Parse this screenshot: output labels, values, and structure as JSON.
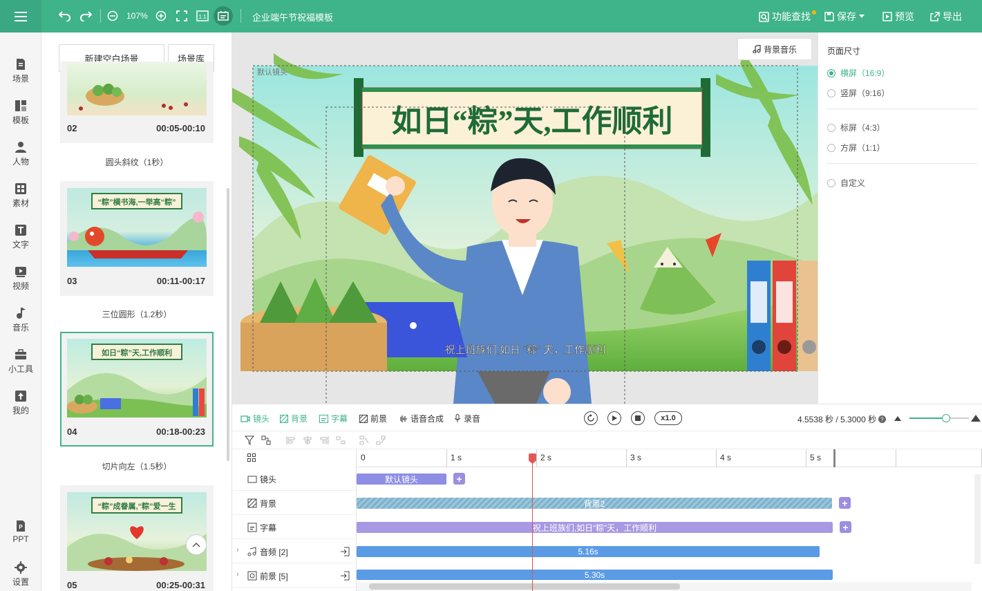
{
  "topbar": {
    "zoom": "107%",
    "title": "企业端午节祝福模板",
    "find_label": "功能查找",
    "save_label": "保存",
    "preview_label": "预览",
    "export_label": "导出"
  },
  "nav": [
    {
      "label": "场景",
      "icon": "scene-icon"
    },
    {
      "label": "模板",
      "icon": "template-icon"
    },
    {
      "label": "人物",
      "icon": "person-icon"
    },
    {
      "label": "素材",
      "icon": "material-icon"
    },
    {
      "label": "文字",
      "icon": "text-icon"
    },
    {
      "label": "视频",
      "icon": "video-icon"
    },
    {
      "label": "音乐",
      "icon": "music-icon"
    },
    {
      "label": "小工具",
      "icon": "toolbox-icon"
    },
    {
      "label": "我的",
      "icon": "upload-icon"
    },
    {
      "label": "PPT",
      "icon": "ppt-icon"
    },
    {
      "label": "设置",
      "icon": "gear-icon"
    }
  ],
  "scenes_panel": {
    "new_label": "新建空白场景",
    "lib_label": "场景库",
    "scenes": [
      {
        "num": "02",
        "time": "00:05-00:10",
        "banner": "",
        "transition": "圆头斜纹（1秒）"
      },
      {
        "num": "03",
        "time": "00:11-00:17",
        "banner": "“粽”横书海,一举高“粽”",
        "transition": "三位圆形（1.2秒）"
      },
      {
        "num": "04",
        "time": "00:18-00:23",
        "banner": "如日“粽”天,工作顺利",
        "transition": "切片向左（1.5秒）"
      },
      {
        "num": "05",
        "time": "00:25-00:31",
        "banner": "“粽”成眷属,“粽”爱一生",
        "transition": ""
      }
    ]
  },
  "canvas": {
    "bgm_label": "背景音乐",
    "camera_tag": "默认镜头",
    "banner": "如日“粽”天,工作顺利",
    "subtitle": "祝上班族们,如日 “粽” 天，工作顺利"
  },
  "page_size": {
    "title": "页面尺寸",
    "options": [
      {
        "label": "横屏（16:9）",
        "selected": true
      },
      {
        "label": "竖屏（9:16）",
        "selected": false
      },
      {
        "label": "标屏（4:3）",
        "selected": false
      },
      {
        "label": "方屏（1:1）",
        "selected": false
      },
      {
        "label": "自定义",
        "selected": false
      }
    ]
  },
  "toolbar": {
    "camera": "镜头",
    "background": "背景",
    "subtitle": "字幕",
    "foreground": "前景",
    "tts": "语音合成",
    "record": "录音",
    "speed": "x1.0",
    "time": "4.5538 秒 / 5.3000 秒"
  },
  "timeline": {
    "ruler": [
      "0",
      "1 s",
      "2 s",
      "3 s",
      "4 s",
      "5 s"
    ],
    "playhead_seconds": 4.5538,
    "duration_seconds": 5.3,
    "rows": [
      {
        "label": "镜头",
        "bar": "默认镜头"
      },
      {
        "label": "背景",
        "bar": "背景2"
      },
      {
        "label": "字幕",
        "bar": "祝上班族们,如日“粽”天，工作顺利"
      },
      {
        "label": "音频 [2]",
        "bar": "5.16s"
      },
      {
        "label": "前景 [5]",
        "bar": "5.30s"
      }
    ]
  },
  "colors": {
    "accent": "#3fb38a",
    "camera_bar": "#8d8ee4",
    "bg_bar": "#7fb2cc",
    "sub_bar": "#a899e2",
    "audio_bar": "#5a9be6",
    "playhead": "#d9534f"
  }
}
